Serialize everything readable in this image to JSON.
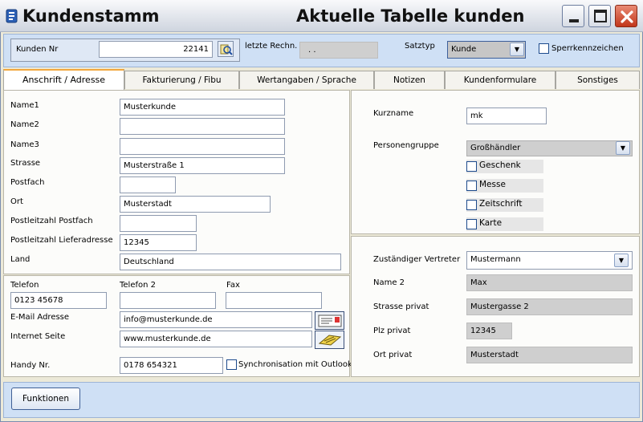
{
  "window": {
    "title_left": "Kundenstamm",
    "title_right": "Aktuelle Tabelle kunden"
  },
  "header": {
    "kunden_nr_label": "Kunden Nr",
    "kunden_nr_value": "22141",
    "letzte_rechn_label": "letzte Rechn.",
    "letzte_rechn_value": ". .",
    "satztyp_label": "Satztyp",
    "satztyp_value": "Kunde",
    "sperrkennzeichen_label": "Sperrkennzeichen"
  },
  "tabs": [
    {
      "label": "Anschrift / Adresse"
    },
    {
      "label": "Fakturierung / Fibu"
    },
    {
      "label": "Wertangaben / Sprache"
    },
    {
      "label": "Notizen"
    },
    {
      "label": "Kundenformulare"
    },
    {
      "label": "Sonstiges"
    }
  ],
  "address": {
    "name1_label": "Name1",
    "name1_value": "Musterkunde",
    "name2_label": "Name2",
    "name2_value": "",
    "name3_label": "Name3",
    "name3_value": "",
    "strasse_label": "Strasse",
    "strasse_value": "Musterstraße 1",
    "postfach_label": "Postfach",
    "postfach_value": "",
    "ort_label": "Ort",
    "ort_value": "Musterstadt",
    "plz_postfach_label": "Postleitzahl Postfach",
    "plz_postfach_value": "",
    "plz_liefer_label": "Postleitzahl Lieferadresse",
    "plz_liefer_value": "12345",
    "land_label": "Land",
    "land_value": "Deutschland"
  },
  "contact": {
    "telefon_label": "Telefon",
    "telefon_value": "0123 45678",
    "telefon2_label": "Telefon 2",
    "telefon2_value": "",
    "fax_label": "Fax",
    "fax_value": "",
    "email_label": "E-Mail Adresse",
    "email_value": "info@musterkunde.de",
    "internet_label": "Internet Seite",
    "internet_value": "www.musterkunde.de",
    "handy_label": "Handy Nr.",
    "handy_value": "0178 654321",
    "sync_label": "Synchronisation mit Outlook"
  },
  "right_top": {
    "kurzname_label": "Kurzname",
    "kurzname_value": "mk",
    "personengruppe_label": "Personengruppe",
    "personengruppe_value": "Großhändler",
    "checkboxes": [
      {
        "label": "Geschenk"
      },
      {
        "label": "Messe"
      },
      {
        "label": "Zeitschrift"
      },
      {
        "label": "Karte"
      }
    ]
  },
  "right_bottom": {
    "vertreter_label": "Zuständiger Vertreter",
    "vertreter_value": "Mustermann",
    "name2_label": "Name 2",
    "name2_value": "Max",
    "strasse_privat_label": "Strasse privat",
    "strasse_privat_value": "Mustergasse 2",
    "plz_privat_label": "Plz privat",
    "plz_privat_value": "12345",
    "ort_privat_label": "Ort privat",
    "ort_privat_value": "Musterstadt"
  },
  "footer": {
    "funktionen_label": "Funktionen"
  }
}
